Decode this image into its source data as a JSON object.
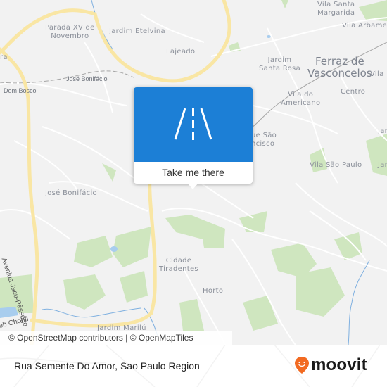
{
  "map": {
    "places": [
      {
        "id": "parada-xv",
        "text": "Parada XV de\nNovembro"
      },
      {
        "id": "jardim-etelvina",
        "text": "Jardim Etelvina"
      },
      {
        "id": "lajeado",
        "text": "Lajeado"
      },
      {
        "id": "jose-bonifacio-station",
        "text": "José Bonifácio"
      },
      {
        "id": "dom-bosco",
        "text": "Dom Bosco"
      },
      {
        "id": "vila-santa-margarida",
        "text": "Vila Santa\nMargarida"
      },
      {
        "id": "vila-arbame",
        "text": "Vila Arbame"
      },
      {
        "id": "jardim-santa-rosa",
        "text": "Jardim\nSanta Rosa"
      },
      {
        "id": "ferraz-de-vasconcelos",
        "text": "Ferraz de\nVasconcelos"
      },
      {
        "id": "vila-right",
        "text": "Vila"
      },
      {
        "id": "centro",
        "text": "Centro"
      },
      {
        "id": "vila-do-americano",
        "text": "Vila do\nAmericano"
      },
      {
        "id": "parque-sao-francisco",
        "text": "ue São\nncisco"
      },
      {
        "id": "vila-sao-paulo",
        "text": "Vila São Paulo"
      },
      {
        "id": "jardim-right",
        "text": "Jardi"
      },
      {
        "id": "jar-right",
        "text": "Jar"
      },
      {
        "id": "jose-bonifacio",
        "text": "José Bonifácio"
      },
      {
        "id": "cidade-tiradentes",
        "text": "Cidade\nTiradentes"
      },
      {
        "id": "horto",
        "text": "Horto"
      },
      {
        "id": "jardim-marilu",
        "text": "Jardim Marilú"
      },
      {
        "id": "edge-ra",
        "text": "ra"
      }
    ],
    "roads": [
      {
        "id": "avenida-jacu-pessego",
        "text": "Avenida Jacu-Pêssego"
      },
      {
        "id": "chohfi",
        "text": "eb Chohfi"
      }
    ],
    "popup": {
      "icon": "road-icon",
      "action_label": "Take me there",
      "color": "#1c7fd6"
    },
    "attribution": "© OpenStreetMap contributors | © OpenMapTiles"
  },
  "footer": {
    "location_title": "Rua Semente Do Amor, Sao Paulo Region",
    "brand": "moovit",
    "brand_color": "#f26a21"
  }
}
